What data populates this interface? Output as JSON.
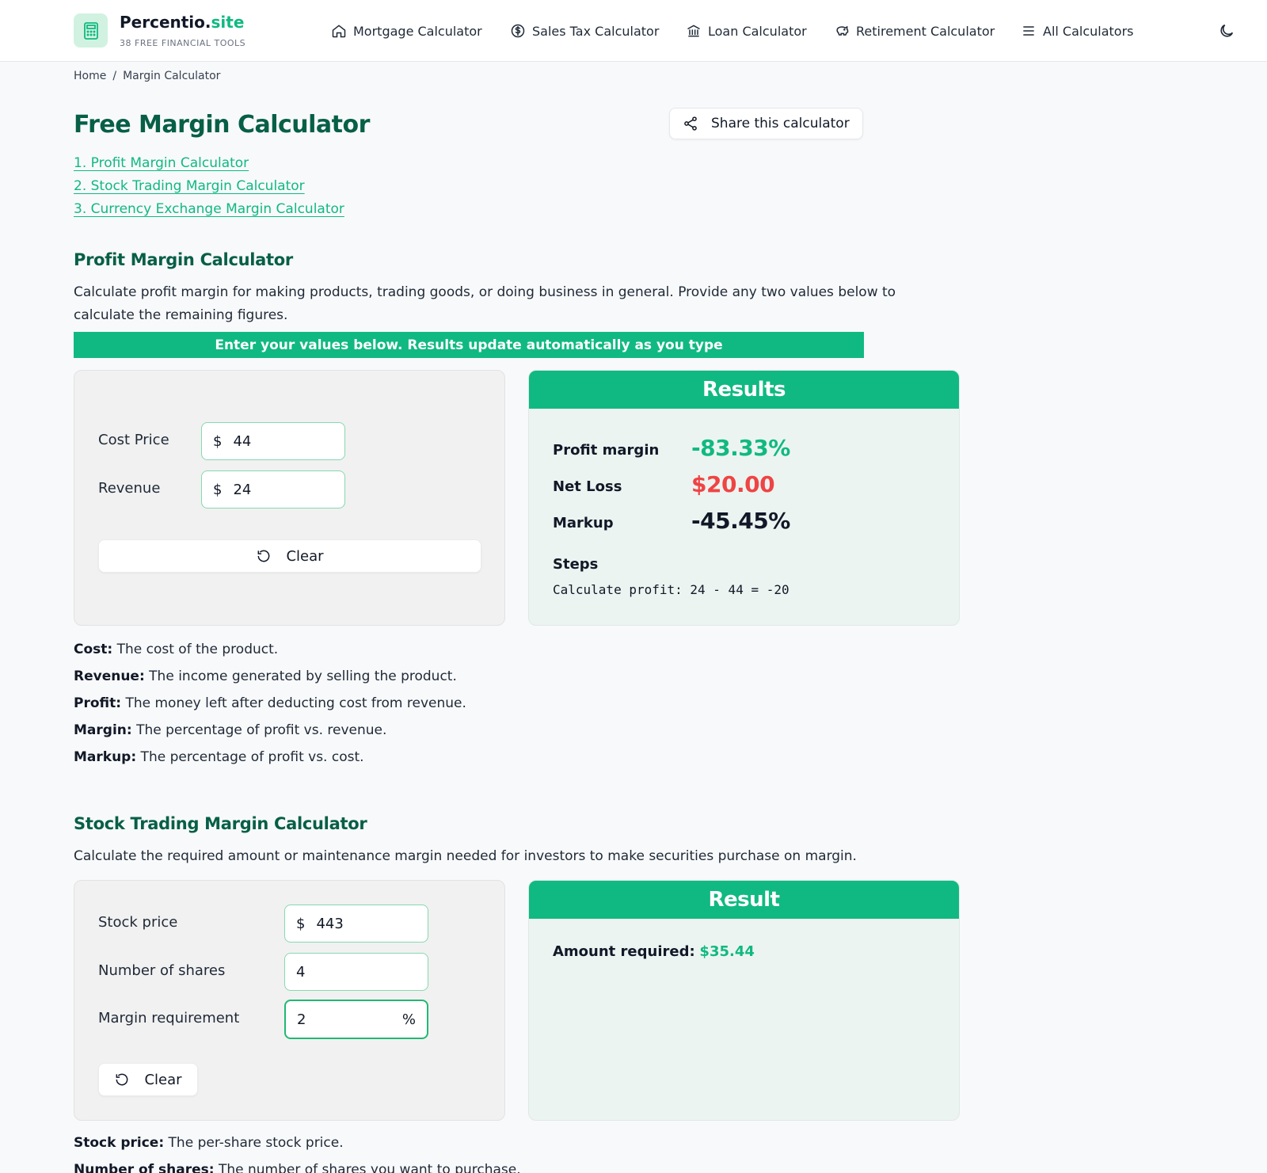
{
  "header": {
    "brand_main": "Percentio.",
    "brand_tld": "site",
    "brand_sub": "38 FREE FINANCIAL TOOLS",
    "nav": [
      {
        "label": "Mortgage Calculator",
        "icon": "home-icon"
      },
      {
        "label": "Sales Tax Calculator",
        "icon": "dollar-circle-icon"
      },
      {
        "label": "Loan Calculator",
        "icon": "bank-icon"
      },
      {
        "label": "Retirement Calculator",
        "icon": "piggy-bank-icon"
      },
      {
        "label": "All Calculators",
        "icon": "menu-icon"
      }
    ]
  },
  "breadcrumb": {
    "home": "Home",
    "sep": "/",
    "current": "Margin Calculator"
  },
  "page": {
    "title": "Free Margin Calculator",
    "share_label": "Share this calculator",
    "toc": [
      "1. Profit Margin Calculator",
      "2. Stock Trading Margin Calculator",
      "3. Currency Exchange Margin Calculator"
    ]
  },
  "profit": {
    "title": "Profit Margin Calculator",
    "desc": "Calculate profit margin for making products, trading goods, or doing business in general. Provide any two values below to calculate the remaining figures.",
    "banner": "Enter your values below. Results update automatically as you type",
    "cost_label": "Cost Price",
    "cost_prefix": "$",
    "cost_value": "44",
    "revenue_label": "Revenue",
    "revenue_prefix": "$",
    "revenue_value": "24",
    "clear_label": "Clear",
    "results_title": "Results",
    "margin_label": "Profit margin",
    "margin_value": "-83.33%",
    "netloss_label": "Net Loss",
    "netloss_value": "$20.00",
    "markup_label": "Markup",
    "markup_value": "-45.45%",
    "steps_label": "Steps",
    "steps_text": "Calculate profit: 24 - 44 = -20",
    "defs": [
      {
        "term": "Cost:",
        "text": " The cost of the product."
      },
      {
        "term": "Revenue:",
        "text": " The income generated by selling the product."
      },
      {
        "term": "Profit:",
        "text": " The money left after deducting cost from revenue."
      },
      {
        "term": "Margin:",
        "text": " The percentage of profit vs. revenue."
      },
      {
        "term": "Markup:",
        "text": " The percentage of profit vs. cost."
      }
    ]
  },
  "stock": {
    "title": "Stock Trading Margin Calculator",
    "desc": "Calculate the required amount or maintenance margin needed for investors to make securities purchase on margin.",
    "price_label": "Stock price",
    "price_prefix": "$",
    "price_value": "443",
    "shares_label": "Number of shares",
    "shares_value": "4",
    "margin_label": "Margin requirement",
    "margin_value": "2",
    "margin_suffix": "%",
    "clear_label": "Clear",
    "result_title": "Result",
    "amount_label": "Amount required:",
    "amount_value": "$35.44",
    "defs": [
      {
        "term": "Stock price:",
        "text": " The per-share stock price."
      },
      {
        "term": "Number of shares:",
        "text": " The number of shares you want to purchase."
      }
    ]
  },
  "colors": {
    "accent": "#10b981",
    "title_green": "#065f46",
    "loss_red": "#ef4444"
  }
}
